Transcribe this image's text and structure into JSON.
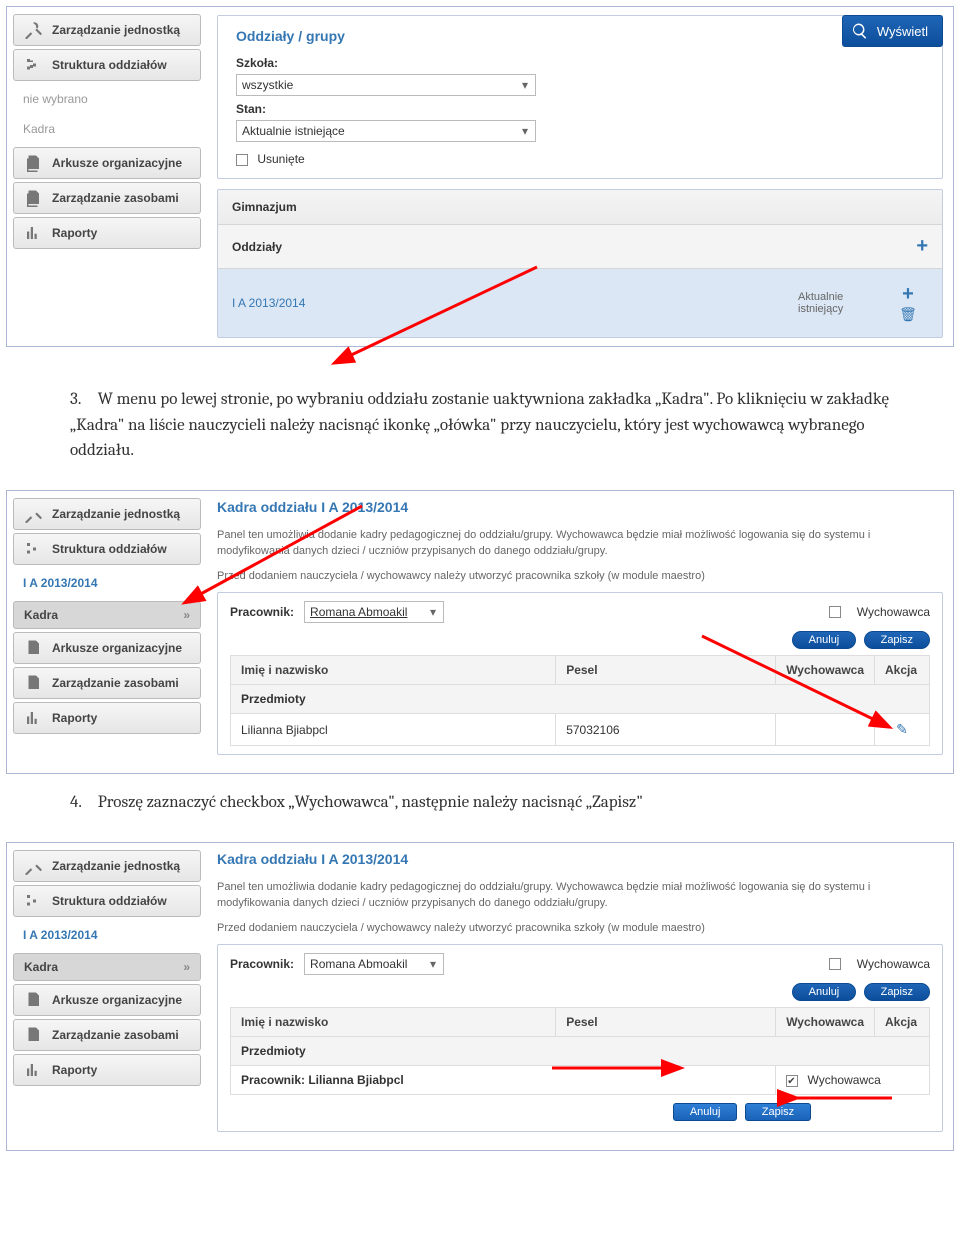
{
  "nav": {
    "unit": "Zarządzanie jednostką",
    "structure": "Struktura oddziałów",
    "none_selected": "nie wybrano",
    "kadra": "Kadra",
    "selected_class": "I A 2013/2014",
    "sheets": "Arkusze organizacyjne",
    "resources": "Zarządzanie zasobami",
    "reports": "Raporty",
    "chevron": "»"
  },
  "show_btn": "Wyświetl",
  "panel1": {
    "title": "Oddziały / grupy",
    "school_label": "Szkoła:",
    "school_value": "wszystkie",
    "state_label": "Stan:",
    "state_value": "Aktualnie istniejące",
    "deleted": "Usunięte"
  },
  "table1": {
    "header": "Gimnazjum",
    "subheader": "Oddziały",
    "row_name": "I A 2013/2014",
    "status1": "Aktualnie",
    "status2": "istniejący"
  },
  "step3": "W menu po lewej stronie, po wybraniu oddziału zostanie uaktywniona zakładka „Kadra\". Po kliknięciu w zakładkę „Kadra\" na liście nauczycieli należy nacisnąć ikonkę „ołówka\" przy nauczycielu, który jest wychowawcą wybranego oddziału.",
  "step3_num": "3.",
  "panel2": {
    "title": "Kadra oddziału I A 2013/2014",
    "desc1": "Panel ten umożliwia dodanie kadry pedagogicznej do oddziału/grupy. Wychowawca będzie miał możliwość logowania się do systemu i modyfikowania danych dzieci / uczniów przypisanych do danego oddziału/grupy.",
    "desc2": "Przed dodaniem nauczyciela / wychowawcy należy utworzyć pracownika szkoły (w module maestro)",
    "worker_label": "Pracownik:",
    "worker_value": "Romana Abmoakil",
    "wych_label": "Wychowawca",
    "btn_cancel": "Anuluj",
    "btn_save": "Zapisz",
    "col_name": "Imię i nazwisko",
    "col_pesel": "Pesel",
    "col_wych": "Wychowawca",
    "col_action": "Akcja",
    "subjects": "Przedmioty",
    "teacher_name": "Lilianna Bjiabpcl",
    "teacher_pesel": "57032106",
    "worker_prefix_row": "Pracownik: Lilianna Bjiabpcl"
  },
  "step4_num": "4.",
  "step4": "Proszę zaznaczyć checkbox „Wychowawca\", następnie należy nacisnąć „Zapisz\""
}
